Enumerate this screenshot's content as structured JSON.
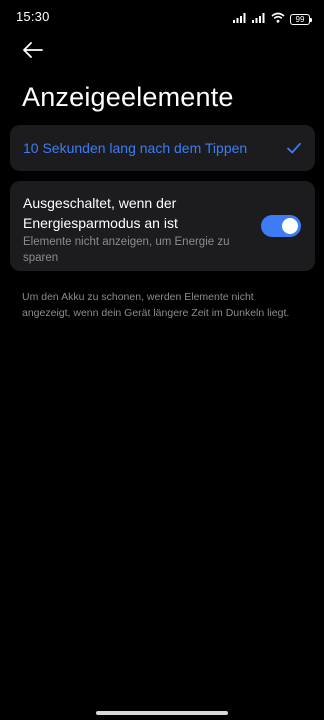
{
  "status_bar": {
    "time": "15:30",
    "battery": "99",
    "icons": [
      "signal-icon",
      "signal-icon",
      "wifi-icon",
      "battery-icon"
    ]
  },
  "header": {
    "back_icon": "arrow-left-icon",
    "title": "Anzeigeelemente"
  },
  "option": {
    "label": "10 Sekunden lang nach dem Tippen",
    "selected": true,
    "check_icon": "check-icon"
  },
  "power_saving": {
    "title": "Ausgeschaltet, wenn der Energiesparmodus an ist",
    "subtitle": "Elemente nicht anzeigen, um Energie zu sparen",
    "enabled": true
  },
  "info": {
    "text": "Um den Akku zu schonen, werden Elemente nicht angezeigt, wenn dein Gerät längere Zeit im Dunkeln liegt."
  },
  "colors": {
    "accent": "#3d7cf4",
    "background": "#000000",
    "card": "#1c1c1e",
    "secondary_text": "#8c8c8f"
  }
}
